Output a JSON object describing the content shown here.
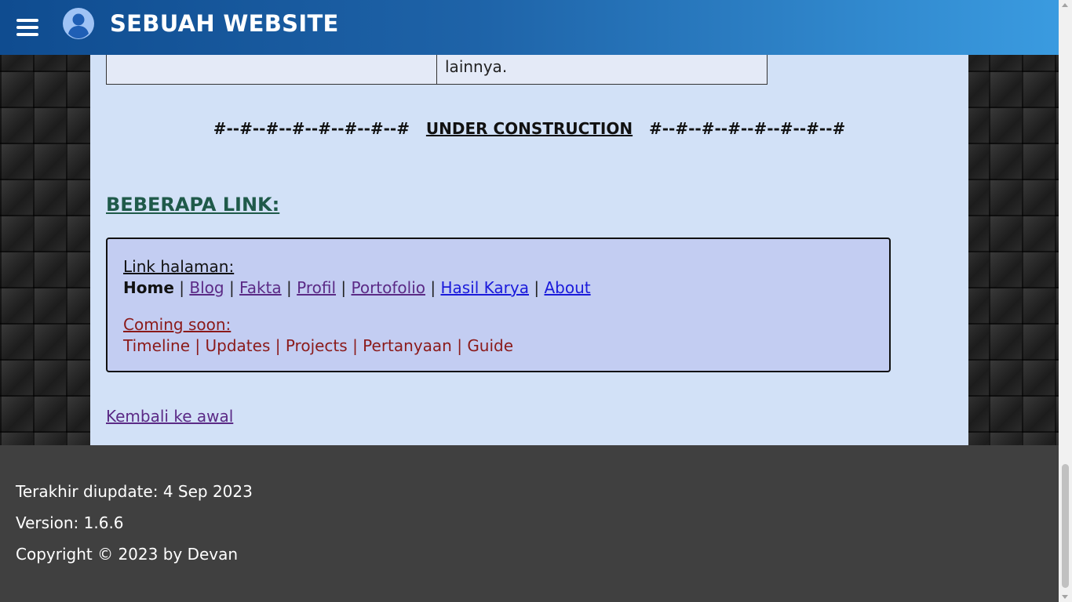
{
  "header": {
    "title": "SEBUAH WEBSITE",
    "menu_icon": "hamburger-menu-icon",
    "avatar_icon": "user-avatar-icon"
  },
  "table_fragment": {
    "cell_text": "lainnya."
  },
  "construction": {
    "left_deco": "#--#--#--#--#--#--#--#",
    "label": "UNDER CONSTRUCTION",
    "right_deco": "#--#--#--#--#--#--#--#"
  },
  "links_section": {
    "heading": "BEBERAPA LINK:",
    "page_links_label": "Link halaman:",
    "page_links": [
      {
        "label": "Home",
        "current": true
      },
      {
        "label": "Blog"
      },
      {
        "label": "Fakta"
      },
      {
        "label": "Profil"
      },
      {
        "label": "Portofolio"
      },
      {
        "label": "Hasil Karya"
      },
      {
        "label": "About"
      }
    ],
    "separator": "|",
    "coming_soon_label": "Coming soon:",
    "coming_soon": [
      "Timeline",
      "Updates",
      "Projects",
      "Pertanyaan",
      "Guide"
    ]
  },
  "back_link": "Kembali ke awal",
  "footer": {
    "last_updated": "Terakhir diupdate: 4 Sep 2023",
    "version": "Version: 1.6.6",
    "copyright": "Copyright © 2023 by Devan"
  },
  "colors": {
    "header_start": "#0f4c90",
    "header_end": "#3a9be0",
    "main_bg": "#d2e1f7",
    "link_box_bg": "#c3cdf2",
    "visited_link": "#5b2a86",
    "unvisited_link": "#1a1adb",
    "coming_soon": "#8b1a1a",
    "heading_green": "#1f5a4a",
    "footer_bg": "#404040"
  }
}
